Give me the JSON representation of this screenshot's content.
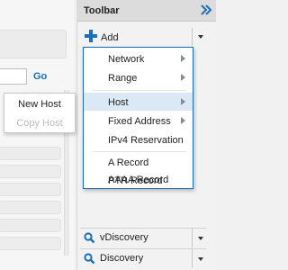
{
  "left": {
    "go_label": "Go"
  },
  "toolbar": {
    "title": "Toolbar",
    "collapse_icon": "double-chevron-right-icon",
    "add_label": "Add",
    "add_icon": "plus-icon",
    "items": [
      {
        "label": "vDiscovery",
        "icon": "search-icon"
      },
      {
        "label": "Discovery",
        "icon": "search-icon"
      }
    ]
  },
  "add_menu": {
    "items": [
      {
        "label": "Network",
        "has_submenu": true
      },
      {
        "label": "Range",
        "has_submenu": true
      },
      {
        "label": "Host",
        "has_submenu": true,
        "highlighted": true
      },
      {
        "label": "Fixed Address",
        "has_submenu": true
      },
      {
        "label": "IPv4 Reservation",
        "has_submenu": false
      },
      {
        "label": "A Record",
        "has_submenu": false
      },
      {
        "label": "PTR Record",
        "has_submenu": false
      },
      {
        "label": "AAAA Record",
        "has_submenu": false
      }
    ]
  },
  "host_submenu": {
    "items": [
      {
        "label": "New Host",
        "enabled": true
      },
      {
        "label": "Copy Host",
        "enabled": false
      }
    ]
  },
  "colors": {
    "accent": "#1a6fb6",
    "highlight": "#dbe8f6",
    "disabled": "#bdbdbd"
  }
}
